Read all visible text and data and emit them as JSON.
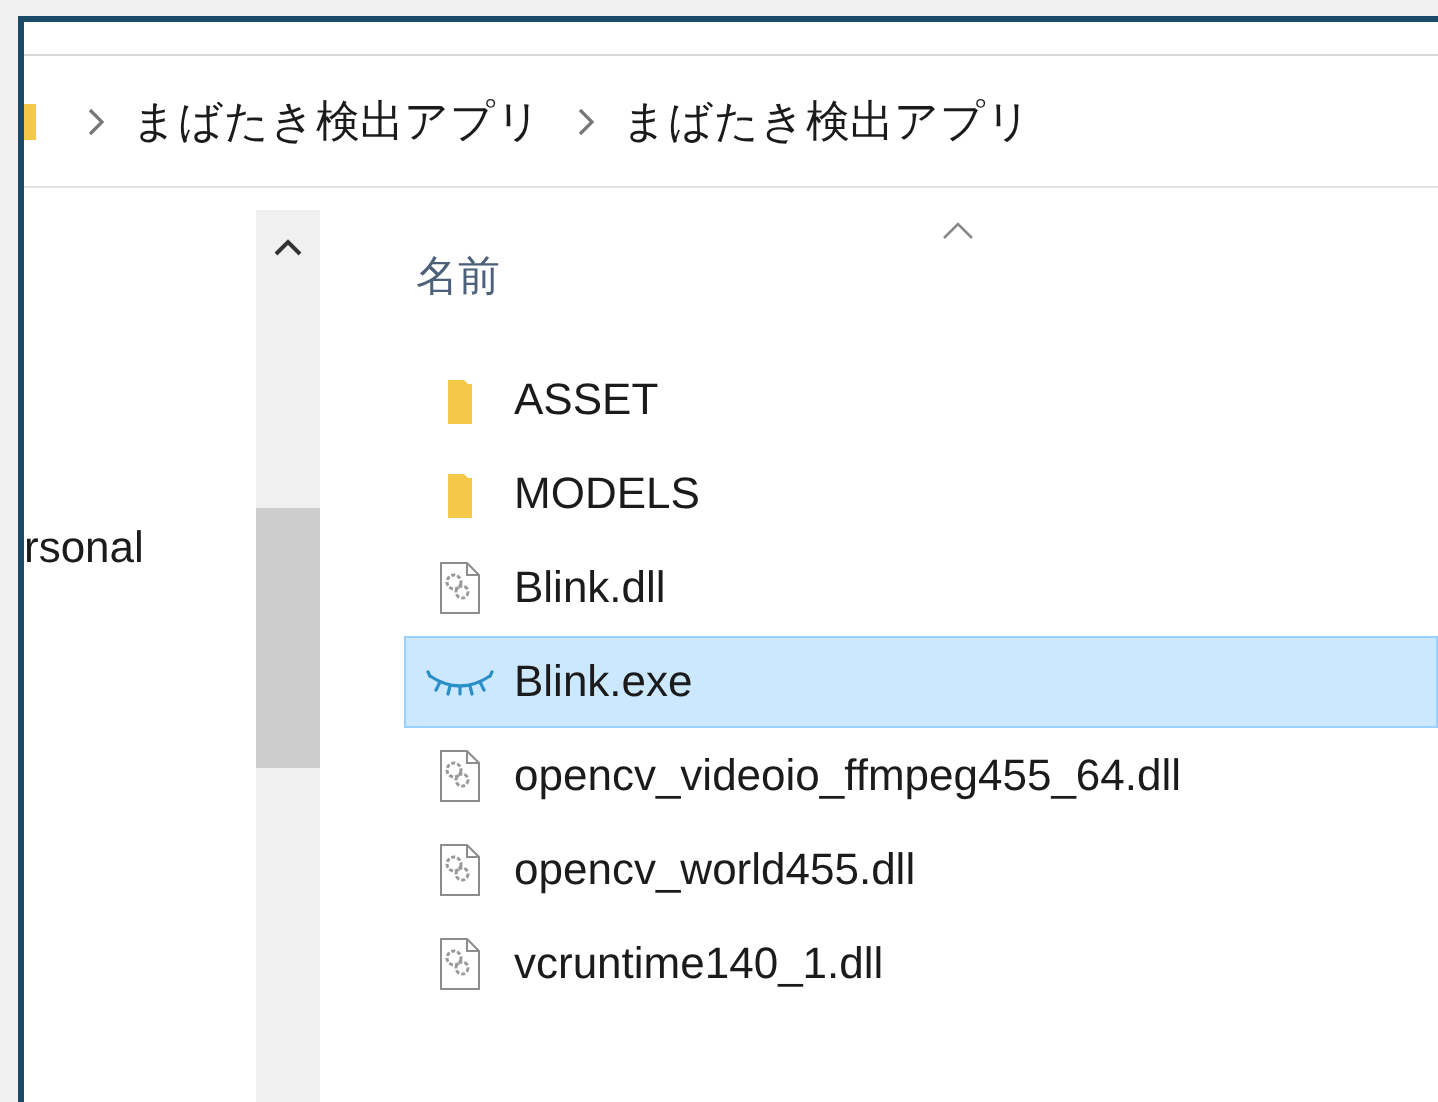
{
  "address_bar": {
    "breadcrumbs": [
      {
        "label": "まばたき検出アプリ"
      },
      {
        "label": "まばたき検出アプリ"
      }
    ]
  },
  "navigation_pane": {
    "items": [
      {
        "label": "rsonal"
      }
    ]
  },
  "file_list": {
    "columns": [
      {
        "label": "名前",
        "sorted_ascending": true
      }
    ],
    "rows": [
      {
        "name": "ASSET",
        "kind": "folder",
        "selected": false
      },
      {
        "name": "MODELS",
        "kind": "folder",
        "selected": false
      },
      {
        "name": "Blink.dll",
        "kind": "dll",
        "selected": false
      },
      {
        "name": "Blink.exe",
        "kind": "exe",
        "selected": true
      },
      {
        "name": "opencv_videoio_ffmpeg455_64.dll",
        "kind": "dll",
        "selected": false
      },
      {
        "name": "opencv_world455.dll",
        "kind": "dll",
        "selected": false
      },
      {
        "name": "vcruntime140_1.dll",
        "kind": "dll",
        "selected": false
      }
    ]
  }
}
